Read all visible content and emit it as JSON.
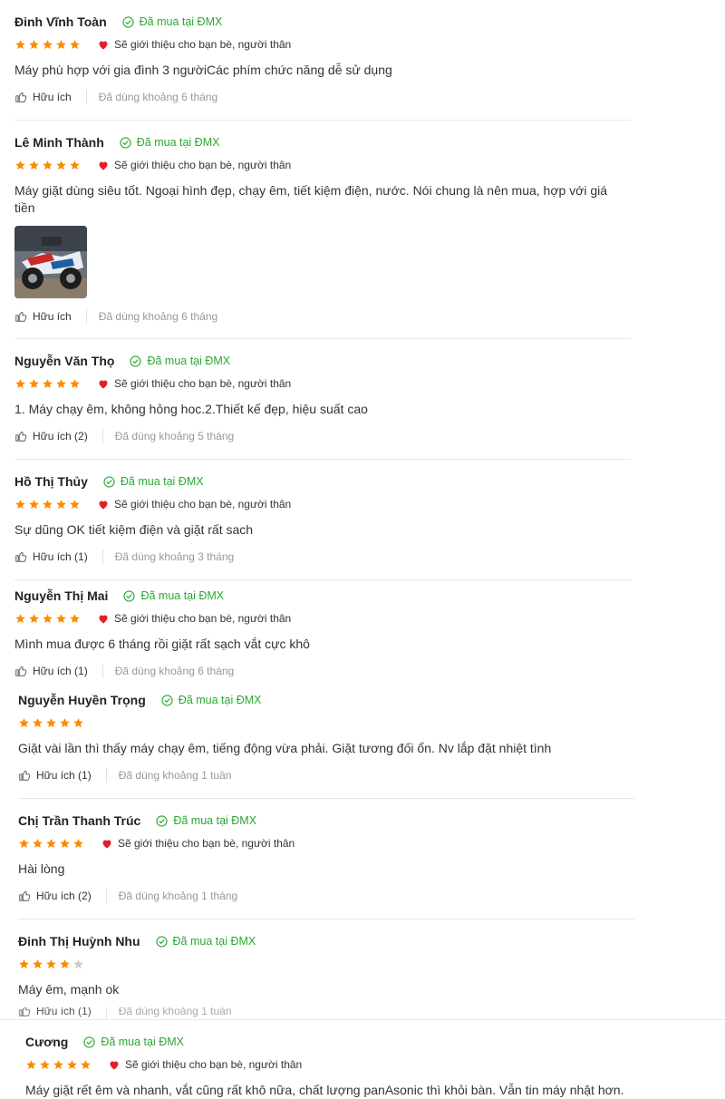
{
  "colors": {
    "star": "#fb8c00",
    "star_empty": "#cccccc",
    "verified": "#2ba832",
    "heart": "#e41e26"
  },
  "icons": {
    "verified": "check-circle-icon",
    "star": "star-icon",
    "recommend": "heart-icon",
    "helpful": "thumbs-up-icon"
  },
  "reviews": [
    {
      "name": "Đinh Vĩnh Toàn",
      "verified": "Đã mua tại ĐMX",
      "rating": 5,
      "recommend": "Sẽ giới thiệu cho bạn bè, người thân",
      "content": "Máy phù hợp với gia đình 3 ngườiCác phím chức năng dễ sử dụng",
      "helpful": "Hữu ích",
      "used": "Đã dùng khoảng 6 tháng"
    },
    {
      "name": "Lê Minh Thành",
      "verified": "Đã mua tại ĐMX",
      "rating": 5,
      "recommend": "Sẽ giới thiệu cho bạn bè, người thân",
      "content": "Máy giặt dùng siêu tốt. Ngoại hình đẹp, chạy êm, tiết kiệm điện, nước. Nói chung là nên mua, hợp với giá tiền",
      "helpful": "Hữu ích",
      "used": "Đã dùng khoảng 6 tháng"
    },
    {
      "name": "Nguyễn Văn Thọ",
      "verified": "Đã mua tại ĐMX",
      "rating": 5,
      "recommend": "Sẽ giới thiệu cho bạn bè, người thân",
      "content": "1. Máy chạy êm, không hỏng hoc.2.Thiết kế đẹp, hiệu suất cao",
      "helpful": "Hữu ích (2)",
      "used": "Đã dùng khoảng 5 tháng"
    },
    {
      "name": "Hồ Thị Thủy",
      "verified": "Đã mua tại ĐMX",
      "rating": 5,
      "recommend": "Sẽ giới thiệu cho bạn bè, người thân",
      "content": "Sự dũng OK tiết kiệm điện và giặt rất sach",
      "helpful": "Hữu ích (1)",
      "used": "Đã dùng khoảng 3 tháng"
    },
    {
      "name": "Nguyễn Thị Mai",
      "verified": "Đã mua tại ĐMX",
      "rating": 5,
      "recommend": "Sẽ giới thiệu cho bạn bè, người thân",
      "content": "Mình mua được 6 tháng rồi giặt rất sạch vắt cực khô",
      "helpful": "Hữu ích (1)",
      "used": "Đã dùng khoảng 6 tháng"
    },
    {
      "name": "Nguyễn Huyền Trọng",
      "verified": "Đã mua tại ĐMX",
      "rating": 5,
      "recommend": "",
      "content": "Giặt vài lần thì thấy máy chạy êm, tiếng động vừa phải. Giặt tương đối ổn. Nv lắp đặt nhiệt tình",
      "helpful": "Hữu ích (1)",
      "used": "Đã dùng khoảng 1 tuần"
    },
    {
      "name": "Chị Trần Thanh Trúc",
      "verified": "Đã mua tại ĐMX",
      "rating": 5,
      "recommend": "Sẽ giới thiệu cho bạn bè, người thân",
      "content": "Hài lòng",
      "helpful": "Hữu ích (2)",
      "used": "Đã dùng khoảng 1 tháng"
    },
    {
      "name": "Đinh Thị Huỳnh Nhu",
      "verified": "Đã mua tại ĐMX",
      "rating": 4,
      "recommend": "",
      "content": "Máy êm, mạnh ok",
      "helpful": "Hữu ích (1)",
      "used": "Đã dùng khoảng 1 tuần"
    },
    {
      "name": "Cương",
      "verified": "Đã mua tại ĐMX",
      "rating": 5,
      "recommend": "Sẽ giới thiệu cho bạn bè, người thân",
      "content": "Máy giặt rết êm và nhanh, vắt cũng rất khô nữa, chất lượng panAsonic thì khỏi bàn. Vẫn tin máy nhật hơn."
    }
  ]
}
